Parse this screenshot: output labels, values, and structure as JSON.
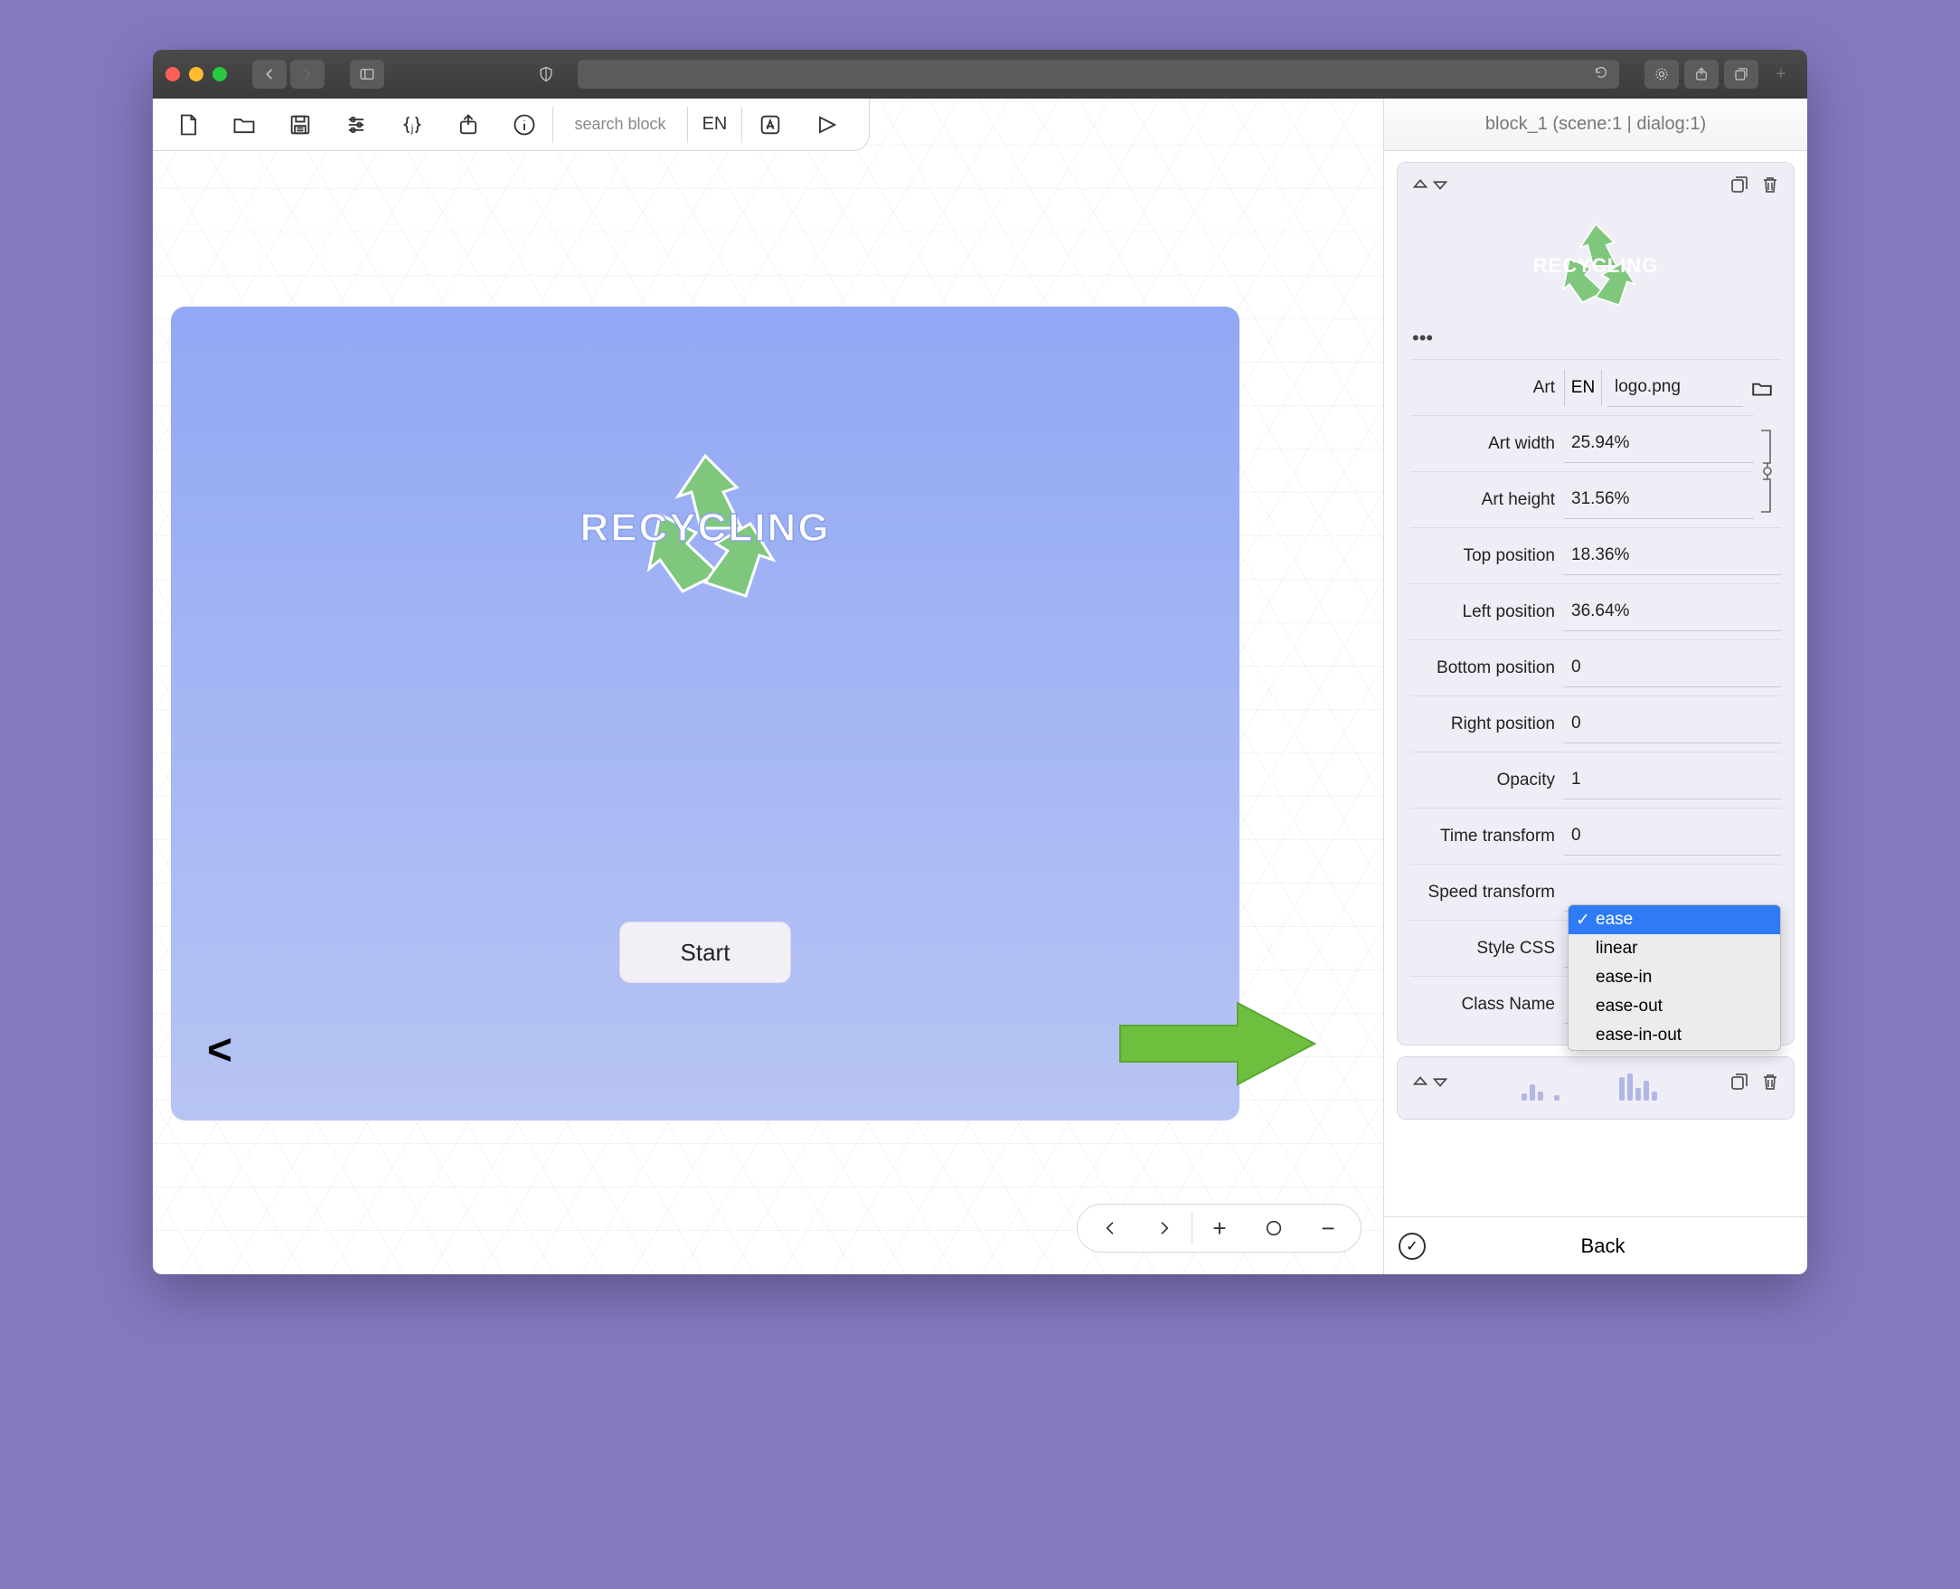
{
  "toolbar": {
    "searchPlaceholder": "search block",
    "lang": "EN"
  },
  "sidebar": {
    "headerTitle": "block_1 (scene:1 | dialog:1)",
    "dots": "•••",
    "art": {
      "label": "Art",
      "lang": "EN",
      "file": "logo.png"
    },
    "props": {
      "artWidth": {
        "label": "Art width",
        "value": "25.94%"
      },
      "artHeight": {
        "label": "Art height",
        "value": "31.56%"
      },
      "topPosition": {
        "label": "Top position",
        "value": "18.36%"
      },
      "leftPosition": {
        "label": "Left position",
        "value": "36.64%"
      },
      "bottomPosition": {
        "label": "Bottom position",
        "value": "0"
      },
      "rightPosition": {
        "label": "Right position",
        "value": "0"
      },
      "opacity": {
        "label": "Opacity",
        "value": "1"
      },
      "timeTransform": {
        "label": "Time transform",
        "value": "0"
      },
      "speedTransform": {
        "label": "Speed transform",
        "value": "ease"
      },
      "styleCSS": {
        "label": "Style CSS",
        "value": ""
      },
      "className": {
        "label": "Class Name",
        "value": ""
      }
    },
    "dropdown": {
      "options": [
        "ease",
        "linear",
        "ease-in",
        "ease-out",
        "ease-in-out"
      ],
      "selected": "ease"
    },
    "footerBack": "Back"
  },
  "scene": {
    "logoText": "RECYCLING",
    "startLabel": "Start",
    "prevArrow": "<",
    "nextArrow": ">"
  },
  "bottomTools": {
    "prev": "‹",
    "next": "›",
    "plus": "+",
    "circle": "◯",
    "minus": "−"
  }
}
